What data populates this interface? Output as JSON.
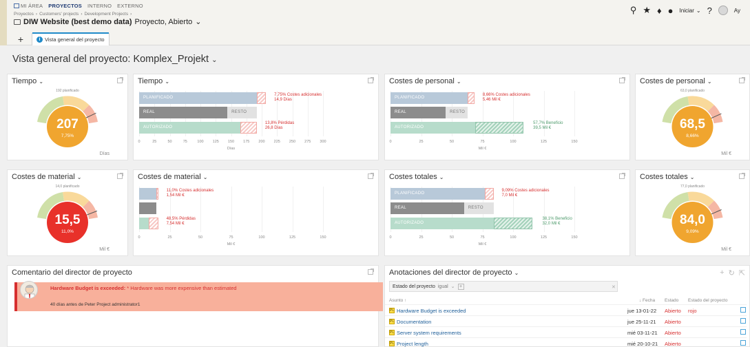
{
  "topnav": {
    "mi_area": "MI ÁREA",
    "proyectos": "PROYECTOS",
    "interno": "INTERNO",
    "externo": "EXTERNO"
  },
  "breadcrumb": [
    "Proyectos",
    "›",
    "Customers' projects",
    "›",
    "Development Projects",
    "›"
  ],
  "project": {
    "name": "DIW Website (best demo data)",
    "meta": "Proyecto, Abierto"
  },
  "tab": {
    "label": "Vista general del proyecto"
  },
  "tools": {
    "iniciar": "Iniciar",
    "user": "Ay"
  },
  "page_title": "Vista general del proyecto: Komplex_Projekt",
  "gauges": {
    "tiempo": {
      "title": "Tiempo",
      "planned": "192 planificado",
      "value": "207",
      "pct": "7,75%",
      "unit": "Días",
      "level": 1.0775,
      "color": "#f0a52f"
    },
    "costes_personal": {
      "title": "Costes de personal",
      "planned": "63,0 planificado",
      "value": "68,5",
      "pct": "8,66%",
      "unit": "Mil €",
      "level": 1.0866,
      "color": "#f0a52f"
    },
    "costes_material": {
      "title": "Costes de material",
      "planned": "14,0 planificado",
      "value": "15,5",
      "pct": "11,0%",
      "unit": "Mil €",
      "level": 1.11,
      "color": "#e8312a"
    },
    "costes_totales": {
      "title": "Costes totales",
      "planned": "77,0 planificado",
      "value": "84,0",
      "pct": "9,09%",
      "unit": "Mil €",
      "level": 1.0909,
      "color": "#f0a52f"
    }
  },
  "bars": {
    "tiempo": {
      "title": "Tiempo",
      "labels": {
        "planificado": "PLANIFICADO",
        "real": "REAL",
        "resto": "RESTO",
        "autorizado": "AUTORIZADO"
      },
      "axis_max": 300,
      "planned": 192,
      "real": 144,
      "resto": 48,
      "autorizado": 192,
      "extra": 14.9,
      "loss": 26.8,
      "note_top": [
        "7,75% Costes adicionales",
        "14,9 Días"
      ],
      "note_bottom": [
        "13,8% Pérdidas",
        "26,8 Días"
      ],
      "ticks": [
        "0",
        "25",
        "50",
        "75",
        "100",
        "125",
        "150",
        "175",
        "200",
        "225",
        "250",
        "275",
        "300"
      ],
      "axis_title": "Días"
    },
    "personal": {
      "title": "Costes de personal",
      "labels": {
        "planificado": "PLANIFICADO",
        "real": "REAL",
        "resto": "RESTO",
        "autorizado": "AUTORIZADO"
      },
      "axis_max": 150,
      "planned": 63,
      "real": 45,
      "resto": 18,
      "autorizado": 108.5,
      "extra": 5.46,
      "benefit": 39.5,
      "note_top": [
        "8,66% Costes adicionales",
        "5,46 Mil €"
      ],
      "note_green": [
        "57,7% Beneficio",
        "39,5 Mil €"
      ],
      "ticks": [
        "0",
        "25",
        "50",
        "75",
        "100",
        "125",
        "150"
      ],
      "axis_title": "Mil €"
    },
    "material": {
      "title": "Costes de material",
      "labels": {
        "planificado": "",
        "real": "",
        "autorizado": ""
      },
      "axis_max": 150,
      "planned": 14,
      "real": 14,
      "autorizado": 15.5,
      "extra": 1.54,
      "loss": 7.54,
      "note_top": [
        "11,0% Costes adicionales",
        "1,54 Mil €"
      ],
      "note_bottom": [
        "48,5% Pérdidas",
        "7,54 Mil €"
      ],
      "ticks": [
        "0",
        "25",
        "50",
        "75",
        "100",
        "125",
        "150"
      ],
      "axis_title": "Mil €"
    },
    "totales": {
      "title": "Costes totales",
      "labels": {
        "planificado": "PLANIFICADO",
        "real": "REAL",
        "resto": "RESTO",
        "autorizado": "AUTORIZADO"
      },
      "axis_max": 150,
      "planned": 77,
      "real": 60,
      "resto": 24,
      "autorizado": 116,
      "extra": 7.0,
      "benefit": 32.0,
      "note_top": [
        "9,09% Costes adicionales",
        "7,0 Mil €"
      ],
      "note_green": [
        "38,1% Beneficio",
        "32,0 Mil €"
      ],
      "ticks": [
        "0",
        "25",
        "50",
        "75",
        "100",
        "125",
        "150"
      ],
      "axis_title": "Mil €"
    }
  },
  "comment": {
    "title": "Comentario del director de proyecto",
    "headline": "Hardware Budget is exceeded:",
    "body": " * Hardware was more expensive than estimated",
    "meta": "40 días antes de Peter Project administrator1"
  },
  "annotations": {
    "title": "Anotaciones del director de proyecto",
    "filter_field": "Estado del proyecto",
    "filter_op": "igual",
    "columns": {
      "asunto": "Asunto ↑",
      "fecha": "↓ Fecha",
      "estado": "Estado",
      "estado_proyecto": "Estado del proyecto"
    },
    "rows": [
      {
        "subject": "Hardware Budget is exceeded",
        "date": "jue 13-01-22",
        "state": "Abierto",
        "pstate": "rojo"
      },
      {
        "subject": "Documentation",
        "date": "jue 25-11-21",
        "state": "Abierto",
        "pstate": ""
      },
      {
        "subject": "Server system requirements",
        "date": "mié 03-11-21",
        "state": "Abierto",
        "pstate": ""
      },
      {
        "subject": "Project length",
        "date": "mié 20-10-21",
        "state": "Abierto",
        "pstate": ""
      }
    ],
    "flag": "PL"
  },
  "colors": {
    "planned": "#b8c9d9",
    "real": "#8c8c8c",
    "resto": "#e2e2e2",
    "authorized": "#b7dccb",
    "red": "#d62f2f",
    "green": "#4d9a6b",
    "accent": "#1f8ac9"
  }
}
